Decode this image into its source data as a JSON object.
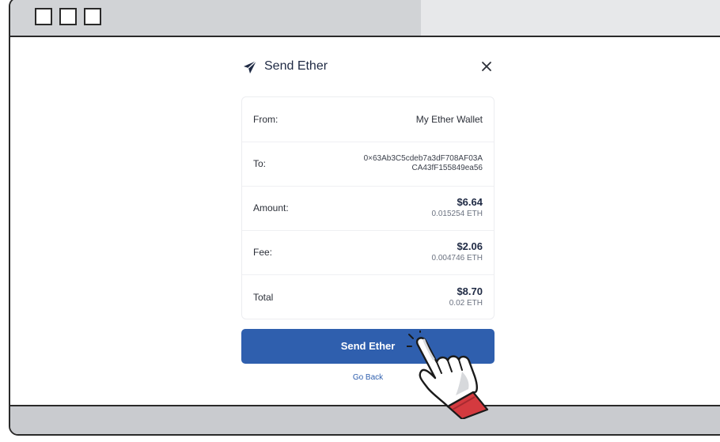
{
  "window": {
    "controls": [
      "square-button",
      "square-button",
      "square-button"
    ]
  },
  "dialog": {
    "title": "Send Ether",
    "icon": "paper-plane-icon",
    "close_icon": "close-icon",
    "rows": [
      {
        "label": "From:",
        "value": "My Ether Wallet"
      },
      {
        "label": "To:",
        "address_line1": "0×63Ab3C5cdeb7a3dF708AF03A",
        "address_line2": "CA43fF155849ea56"
      },
      {
        "label": "Amount:",
        "usd": "$6.64",
        "eth": "0.015254 ETH"
      },
      {
        "label": "Fee:",
        "usd": "$2.06",
        "eth": "0.004746 ETH"
      },
      {
        "label": "Total",
        "usd": "$8.70",
        "eth": "0.02 ETH"
      }
    ],
    "send_button": "Send Ether",
    "back_link": "Go Back"
  },
  "colors": {
    "primary": "#2f5fae",
    "title_text": "#1f2a44",
    "titlebar": "#d1d3d6",
    "cuff": "#d43a3f"
  }
}
